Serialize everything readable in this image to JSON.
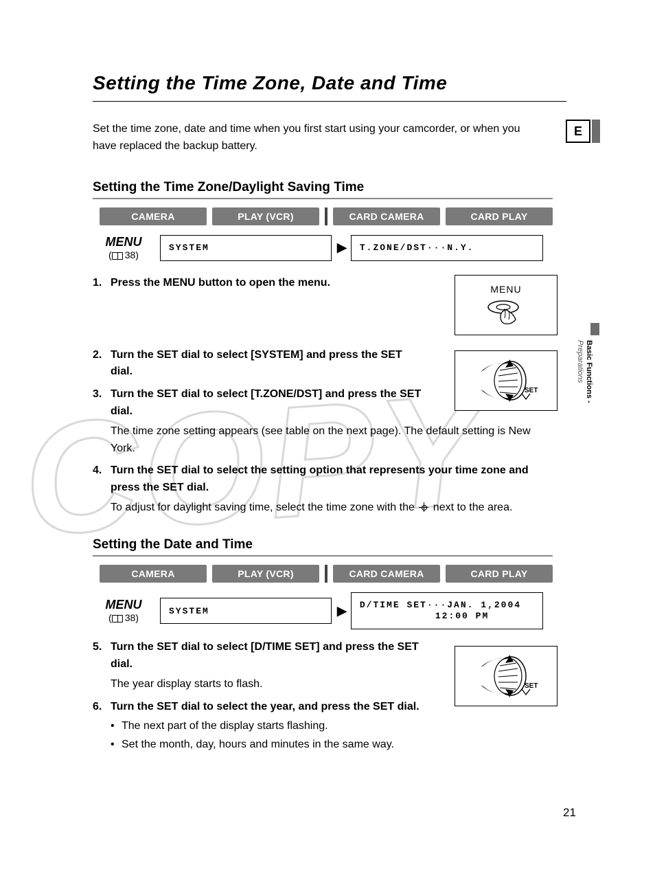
{
  "title": "Setting the Time Zone, Date and Time",
  "intro": "Set the time zone, date and time when you first start using your camcorder, or when you have replaced the backup battery.",
  "lang_badge": "E",
  "section1": {
    "title": "Setting the Time Zone/Daylight Saving Time",
    "modes": [
      "CAMERA",
      "PLAY (VCR)",
      "CARD CAMERA",
      "CARD PLAY"
    ],
    "menu_label": "MENU",
    "menu_ref": "38",
    "menu_left": "SYSTEM",
    "menu_right": "T.ZONE/DST···N.Y."
  },
  "section2": {
    "title": "Setting the Date and Time",
    "modes": [
      "CAMERA",
      "PLAY (VCR)",
      "CARD CAMERA",
      "CARD PLAY"
    ],
    "menu_label": "MENU",
    "menu_ref": "38",
    "menu_left": "SYSTEM",
    "menu_right_line1": "D/TIME SET···JAN. 1,2004",
    "menu_right_line2": "12:00 PM"
  },
  "steps": {
    "s1": {
      "num": "1.",
      "head": "Press the MENU button to open the menu."
    },
    "s2": {
      "num": "2.",
      "head": "Turn the SET dial to select [SYSTEM] and press the SET dial."
    },
    "s3": {
      "num": "3.",
      "head": "Turn the SET dial to select [T.ZONE/DST] and press the SET dial.",
      "body": "The time zone setting appears (see table on the next page). The default setting is New York."
    },
    "s4": {
      "num": "4.",
      "head": "Turn the SET dial to select the setting option that represents your time zone and press the SET dial.",
      "body_pre": "To adjust for daylight saving time, select the time zone with the ",
      "body_post": " next to the area."
    },
    "s5": {
      "num": "5.",
      "head": "Turn the SET dial to select [D/TIME SET] and press the SET dial.",
      "body": "The year display starts to flash."
    },
    "s6": {
      "num": "6.",
      "head": "Turn the SET dial to select the year, and press the SET dial.",
      "bullets": [
        "The next part of the display starts flashing.",
        "Set the month, day, hours and minutes in the same way."
      ]
    }
  },
  "illus_menu_label": "MENU",
  "sidetab": {
    "main": "Basic Functions -",
    "sub": "Preparations"
  },
  "watermark": "COPY",
  "page_number": "21"
}
